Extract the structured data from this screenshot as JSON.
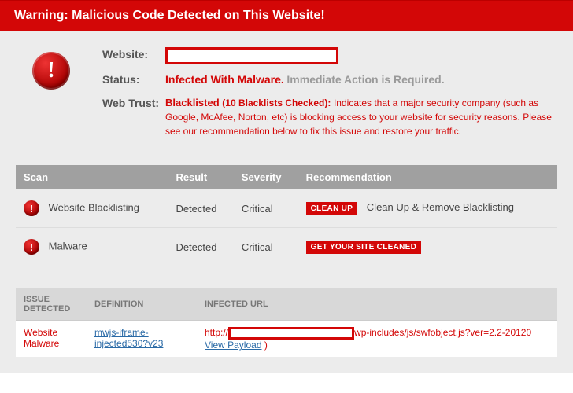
{
  "banner": "Warning: Malicious Code Detected on This Website!",
  "summary": {
    "website_label": "Website:",
    "status_label": "Status:",
    "status_value": "Infected With Malware.",
    "status_extra": "Immediate Action is Required.",
    "trust_label": "Web Trust:",
    "trust_value": "Blacklisted",
    "trust_count": "(10 Blacklists Checked):",
    "trust_desc": "Indicates that a major security company (such as Google, McAfee, Norton, etc) is blocking access to your website for security reasons. Please see our recommendation below to fix this issue and restore your traffic."
  },
  "scan": {
    "headers": {
      "c1": "Scan",
      "c2": "Result",
      "c3": "Severity",
      "c4": "Recommendation"
    },
    "rows": [
      {
        "name": "Website Blacklisting",
        "result": "Detected",
        "severity": "Critical",
        "badge": "CLEAN UP",
        "rec": "Clean Up & Remove Blacklisting"
      },
      {
        "name": "Malware",
        "result": "Detected",
        "severity": "Critical",
        "badge": "GET YOUR SITE CLEANED",
        "rec": ""
      }
    ]
  },
  "detail": {
    "headers": {
      "c1": "ISSUE DETECTED",
      "c2": "DEFINITION",
      "c3": "INFECTED URL"
    },
    "rows": [
      {
        "issue": "Website Malware",
        "definition": "mwjs-iframe-injected530?v23",
        "url_prefix": "http://",
        "url_suffix": "wp-includes/js/swfobject.js?ver=2.2-20120",
        "payload_link": "View Payload",
        "payload_suffix": " )"
      }
    ]
  }
}
